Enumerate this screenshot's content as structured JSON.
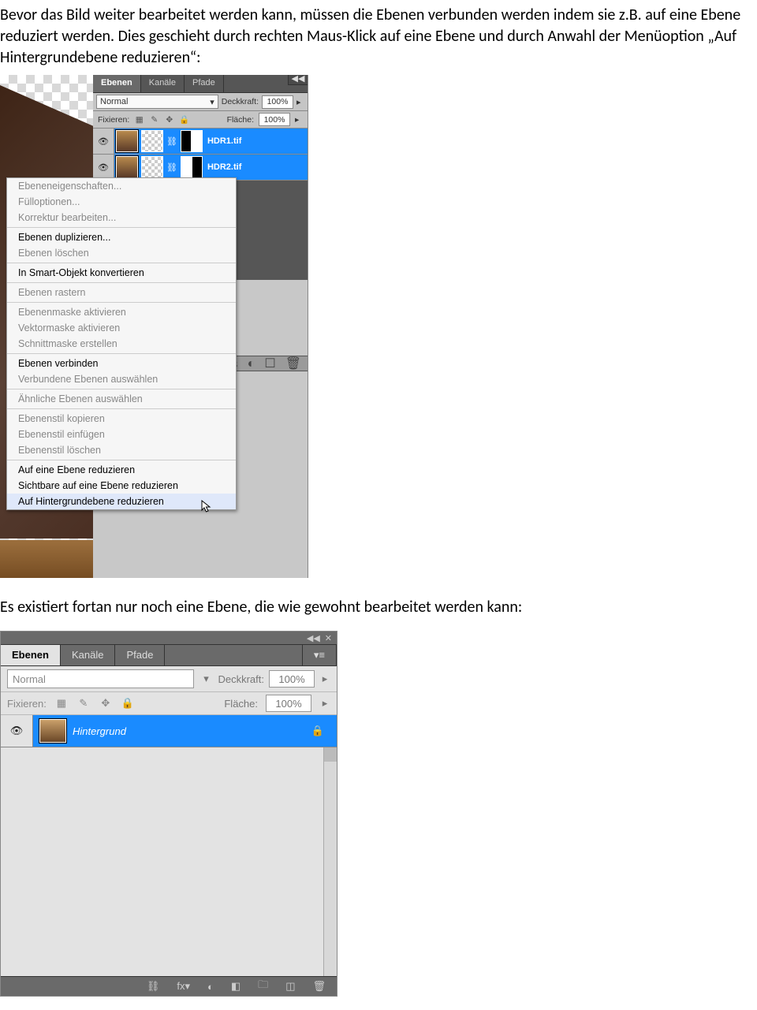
{
  "intro": "Bevor das Bild weiter bearbeitet werden kann, müssen die Ebenen verbunden werden indem sie z.B. auf eine Ebene reduziert werden. Dies geschieht durch rechten Maus-Klick auf eine Ebene und durch Anwahl der Menüoption „Auf Hintergrundebene reduzieren“:",
  "outro": "Es existiert fortan nur noch eine Ebene, die wie gewohnt bearbeitet werden kann:",
  "panel1": {
    "tabs": {
      "a": "Ebenen",
      "b": "Kanäle",
      "c": "Pfade"
    },
    "collapse": "◀◀",
    "blend": "Normal",
    "blend_arrow": "▾",
    "opacity_label": "Deckkraft:",
    "opacity_value": "100%",
    "lock_label": "Fixieren:",
    "fill_label": "Fläche:",
    "fill_value": "100%",
    "layers": [
      {
        "name": "HDR1.tif"
      },
      {
        "name": "HDR2.tif"
      }
    ],
    "foot_icons": {
      "a": "⎌",
      "b": "◐",
      "c": "☐",
      "d": "🗑"
    }
  },
  "context_menu": {
    "g1": [
      {
        "t": "Ebeneneigenschaften...",
        "d": true
      },
      {
        "t": "Fülloptionen...",
        "d": true
      },
      {
        "t": "Korrektur bearbeiten...",
        "d": true
      }
    ],
    "g2": [
      {
        "t": "Ebenen duplizieren...",
        "d": false
      },
      {
        "t": "Ebenen löschen",
        "d": true
      }
    ],
    "g3": [
      {
        "t": "In Smart-Objekt konvertieren",
        "d": false
      }
    ],
    "g4": [
      {
        "t": "Ebenen rastern",
        "d": true
      }
    ],
    "g5": [
      {
        "t": "Ebenenmaske aktivieren",
        "d": true
      },
      {
        "t": "Vektormaske aktivieren",
        "d": true
      },
      {
        "t": "Schnittmaske erstellen",
        "d": true
      }
    ],
    "g6": [
      {
        "t": "Ebenen verbinden",
        "d": false
      },
      {
        "t": "Verbundene Ebenen auswählen",
        "d": true
      }
    ],
    "g7": [
      {
        "t": "Ähnliche Ebenen auswählen",
        "d": true
      }
    ],
    "g8": [
      {
        "t": "Ebenenstil kopieren",
        "d": true
      },
      {
        "t": "Ebenenstil einfügen",
        "d": true
      },
      {
        "t": "Ebenenstil löschen",
        "d": true
      }
    ],
    "g9": [
      {
        "t": "Auf eine Ebene reduzieren",
        "d": false
      },
      {
        "t": "Sichtbare auf eine Ebene reduzieren",
        "d": false
      },
      {
        "t": "Auf Hintergrundebene reduzieren",
        "d": false,
        "hover": true
      }
    ]
  },
  "panel2": {
    "head_icons": {
      "a": "◀◀",
      "b": "✕"
    },
    "tabs": {
      "a": "Ebenen",
      "b": "Kanäle",
      "c": "Pfade"
    },
    "blend": "Normal",
    "blend_arrow": "▾",
    "opacity_label": "Deckkraft:",
    "opacity_value": "100%",
    "lock_label": "Fixieren:",
    "fill_label": "Fläche:",
    "fill_value": "100%",
    "layer_name": "Hintergrund",
    "foot": {
      "a": "⛓",
      "b": "fx▾",
      "c": "◐",
      "d": "◧",
      "e": "🗀",
      "f": "◫",
      "g": "🗑"
    }
  }
}
